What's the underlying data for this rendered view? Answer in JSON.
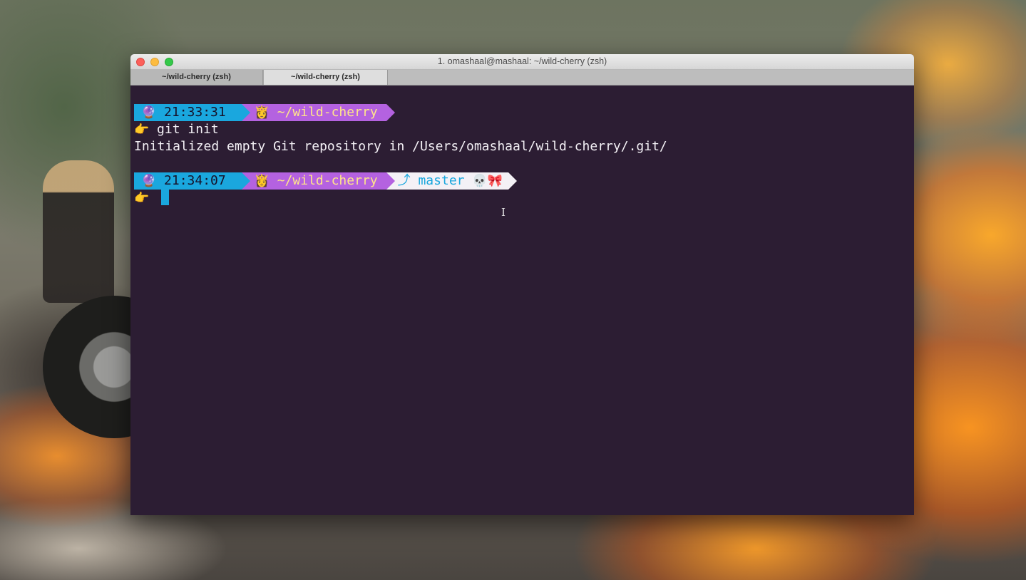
{
  "window": {
    "title": "1. omashaal@mashaal: ~/wild-cherry (zsh)",
    "tabs": [
      {
        "label": "~/wild-cherry (zsh)"
      },
      {
        "label": "~/wild-cherry (zsh)"
      }
    ]
  },
  "terminal": {
    "prompt1": {
      "time_icon": "🔮",
      "time": "21:33:31",
      "path_icon": "👸",
      "path": "~/wild-cherry"
    },
    "command1": {
      "pointer": "👉",
      "text": "git init"
    },
    "output1": "Initialized empty Git repository in /Users/omashaal/wild-cherry/.git/",
    "prompt2": {
      "time_icon": "🔮",
      "time": "21:34:07",
      "path_icon": "👸",
      "path": "~/wild-cherry",
      "branch_icon": "⤴",
      "branch": "master",
      "status_icons": "💀🎀"
    },
    "command2": {
      "pointer": "👉",
      "text": ""
    }
  },
  "colors": {
    "terminal_bg": "#2c1d33",
    "time_segment": "#1aa7de",
    "path_segment": "#b462e0",
    "branch_segment": "#f4f1f6",
    "path_text": "#ffe58a"
  }
}
